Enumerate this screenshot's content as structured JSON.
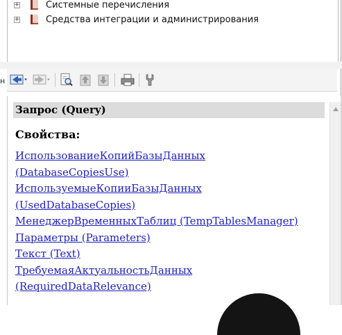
{
  "tree": {
    "items": [
      {
        "expander": "+",
        "label": "Системные перечисления"
      },
      {
        "expander": "+",
        "label": "Средства интеграции и администрирования"
      }
    ]
  },
  "left_cut_text": "н",
  "toolbar": {
    "buttons": [
      "back-icon",
      "forward-icon",
      "find-icon",
      "move-up-icon",
      "move-down-icon",
      "print-icon",
      "settings-icon"
    ]
  },
  "help": {
    "title": "Запрос (Query)",
    "properties_heading": "Свойства:",
    "links": [
      "ИспользованиеКопийБазыДанных",
      "(DatabaseCopiesUse)",
      "ИспользуемыеКопииБазыДанных",
      "(UsedDatabaseCopies)",
      "МенеджерВременныхТаблиц (TempTablesManager)",
      "Параметры (Parameters)",
      "Текст (Text)",
      "ТребуемаяАктуальностьДанных",
      "(RequiredDataRelevance)"
    ]
  },
  "colors": {
    "link": "#1f1fbf",
    "header_bg": "#dcdcdc",
    "book_red": "#b5462f"
  }
}
